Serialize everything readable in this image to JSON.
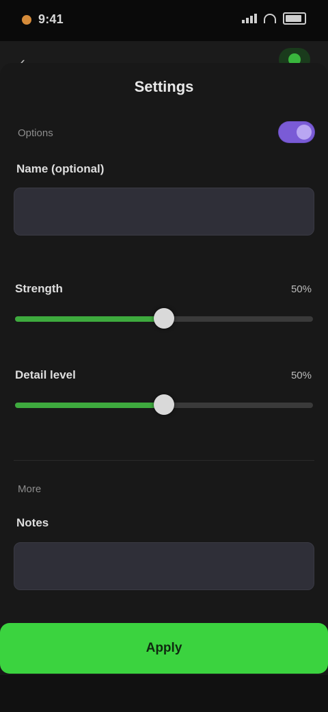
{
  "status_bar": {
    "time": "9:41",
    "icons": [
      "dot-icon",
      "signal-icon",
      "wifi-icon",
      "battery-icon"
    ]
  },
  "header": {
    "back_icon": "chevron-left-icon",
    "action_icon": "check-icon"
  },
  "sheet": {
    "title": "Settings",
    "section_label": "Options",
    "toggle_on": true,
    "text_field": {
      "label": "Name (optional)",
      "value": "",
      "placeholder": ""
    },
    "sliders": [
      {
        "label": "Strength",
        "value_text": "50%",
        "fill_fraction": 0.5,
        "hint": ""
      },
      {
        "label": "Detail level",
        "value_text": "50%",
        "fill_fraction": 0.5,
        "hint": ""
      }
    ],
    "more_label": "More",
    "notes": {
      "label": "Notes",
      "value": "",
      "placeholder": ""
    }
  },
  "primary_button": {
    "label": "Apply"
  },
  "colors": {
    "accent_green": "#3bd33f",
    "slider_green": "#3eaa3e",
    "toggle_purple": "#7a5bd6",
    "background": "#121212"
  }
}
